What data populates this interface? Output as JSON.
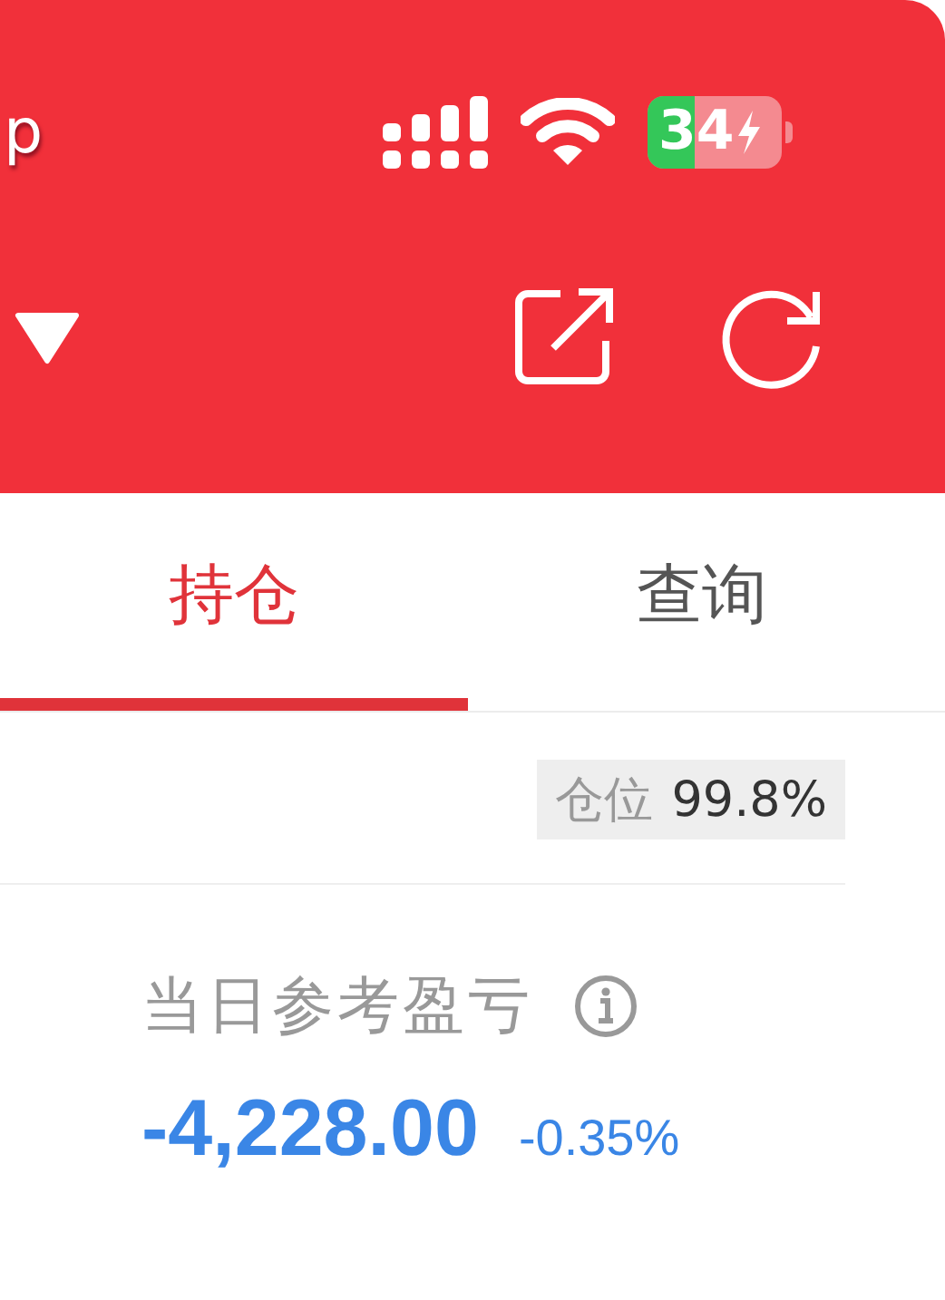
{
  "status_bar": {
    "left_text": "p",
    "battery": "34"
  },
  "tabs": [
    {
      "label": "持仓",
      "selected": true
    },
    {
      "label": "查询",
      "selected": false
    }
  ],
  "position": {
    "label": "仓位",
    "value": "99.8%"
  },
  "daily_pnl": {
    "label": "当日参考盈亏",
    "amount": "-4,228.00",
    "percent": "-0.35%"
  }
}
